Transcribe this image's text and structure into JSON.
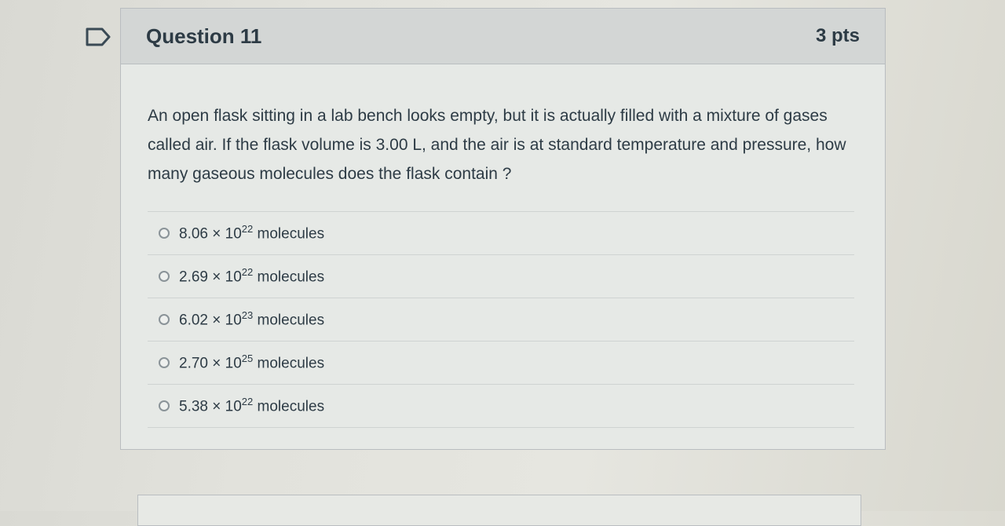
{
  "question": {
    "title": "Question 11",
    "points": "3 pts",
    "text": "An open flask sitting in a lab bench looks empty, but it is actually filled with a mixture of gases called air. If the flask volume is 3.00 L, and the air is at standard temperature and pressure, how many gaseous molecules does the flask contain ?"
  },
  "answers": [
    {
      "mantissa": "8.06 × 10",
      "exponent": "22",
      "unit": "molecules"
    },
    {
      "mantissa": "2.69 × 10",
      "exponent": "22",
      "unit": "molecules"
    },
    {
      "mantissa": "6.02 × 10",
      "exponent": "23",
      "unit": "molecules"
    },
    {
      "mantissa": "2.70 × 10",
      "exponent": "25",
      "unit": "molecules"
    },
    {
      "mantissa": "5.38 × 10",
      "exponent": "22",
      "unit": "molecules"
    }
  ],
  "icons": {
    "flag": "bookmark-flag-icon",
    "radio": "radio-unselected-icon"
  }
}
